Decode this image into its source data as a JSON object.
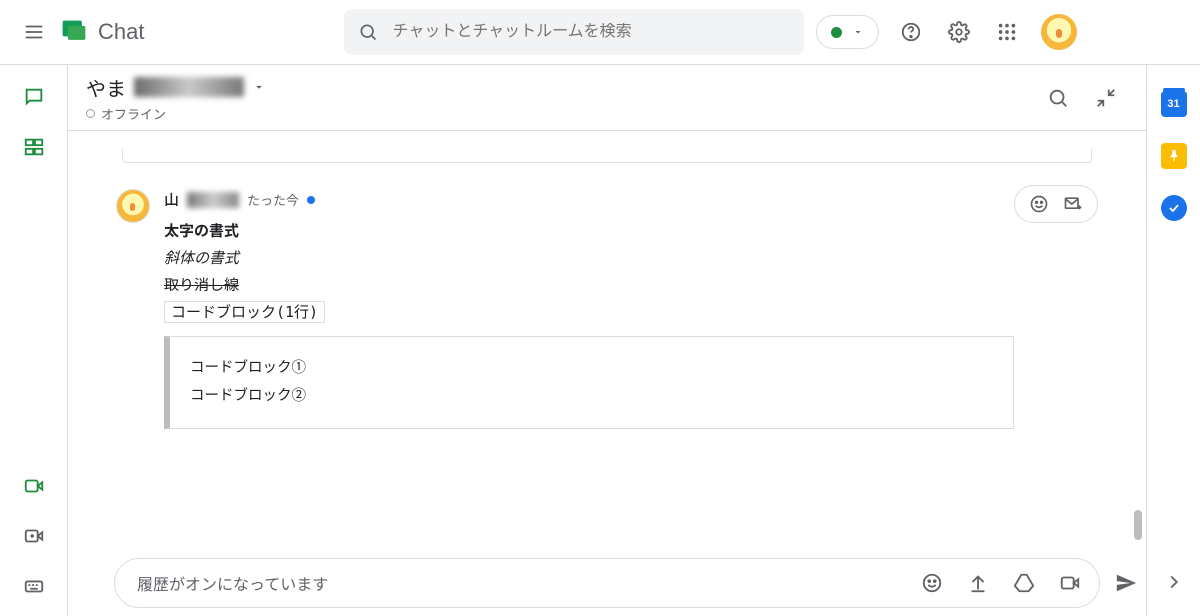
{
  "header": {
    "app_name": "Chat",
    "search_placeholder": "チャットとチャットルームを検索"
  },
  "conversation": {
    "title_prefix": "やま",
    "status_label": "オフライン"
  },
  "message": {
    "sender_prefix": "山",
    "timestamp": "たった今",
    "bold_line": "太字の書式",
    "italic_line": "斜体の書式",
    "strike_line": "取り消し線",
    "inline_code": "コードブロック(1行)",
    "code_line_1": "コードブロック①",
    "code_line_2": "コードブロック②"
  },
  "composer": {
    "hint": "履歴がオンになっています"
  },
  "right_rail": {
    "calendar_day": "31"
  }
}
